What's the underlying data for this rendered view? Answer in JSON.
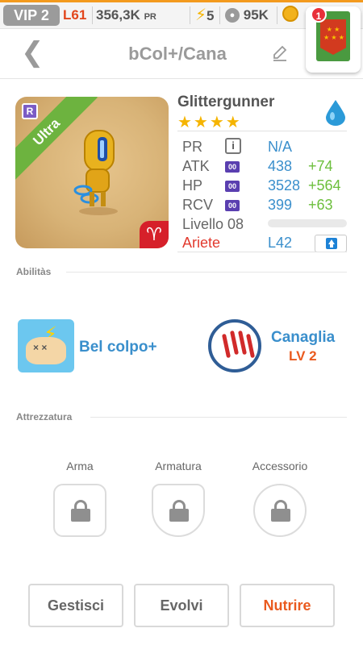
{
  "statusbar": {
    "vip": "VIP 2",
    "level": "L61",
    "power": "356,3K",
    "power_suffix": "PR",
    "energy": "5",
    "food": "95K",
    "notification_count": "1"
  },
  "header": {
    "title": "bCol+/Cana"
  },
  "creature": {
    "name": "Glittergunner",
    "rarity": "Ultra",
    "rank_letter": "R",
    "stars": "★★★★",
    "star_count": 4,
    "zodiac_symbol": "♈",
    "sign": "Ariete",
    "level_cap": "L42",
    "stats": [
      {
        "label": "PR",
        "value": "N/A",
        "bonus": ""
      },
      {
        "label": "ATK",
        "value": "438",
        "bonus": "+74"
      },
      {
        "label": "HP",
        "value": "3528",
        "bonus": "+564"
      },
      {
        "label": "RCV",
        "value": "399",
        "bonus": "+63"
      }
    ],
    "stat_icon_text": "00",
    "info_icon_text": "i",
    "level_label": "Livello 08"
  },
  "abilities": {
    "section_title": "Abilitàs",
    "items": [
      {
        "label": "Bel colpo+",
        "level": ""
      },
      {
        "label": "Canaglia",
        "level": "LV 2"
      }
    ]
  },
  "equipment": {
    "section_title": "Attrezzatura",
    "slots": [
      {
        "label": "Arma"
      },
      {
        "label": "Armatura"
      },
      {
        "label": "Accessorio"
      }
    ]
  },
  "actions": {
    "manage": "Gestisci",
    "evolve": "Evolvi",
    "feed": "Nutrire"
  },
  "colors": {
    "accent_orange": "#ea5a1e",
    "accent_blue": "#3a8fcc",
    "bonus_green": "#6cbf3c",
    "rarity_green": "#6db33f",
    "zodiac_red": "#d6202a"
  }
}
